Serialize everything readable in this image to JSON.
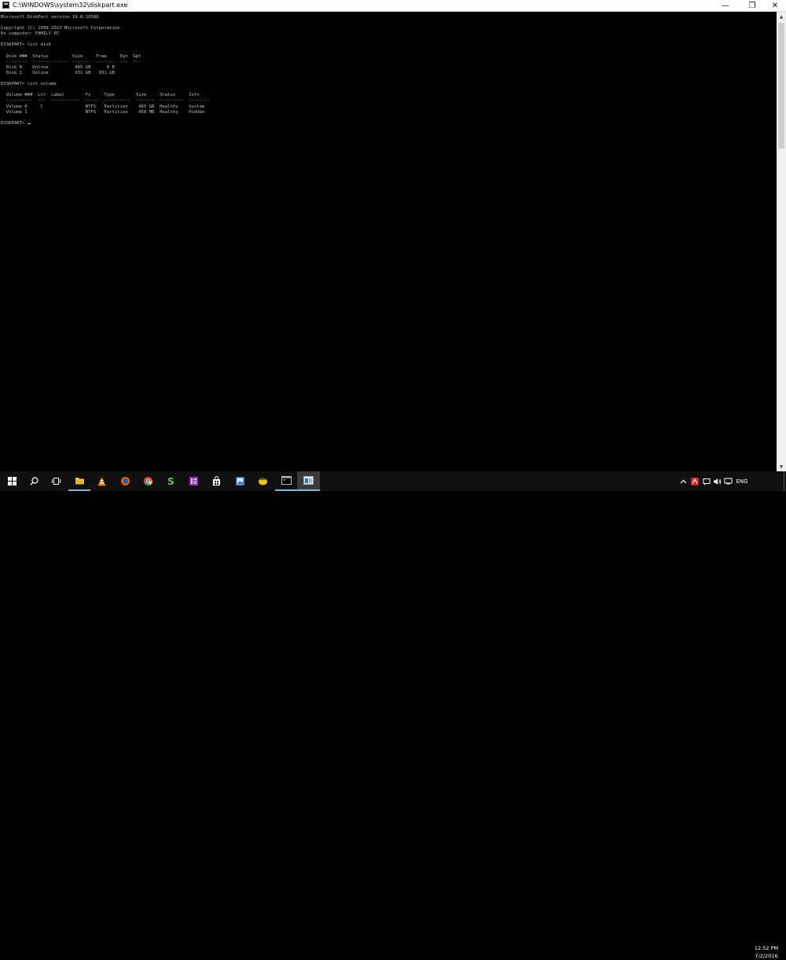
{
  "window": {
    "title": "C:\\WINDOWS\\system32\\diskpart.exe",
    "minimize_glyph": "—",
    "maximize_glyph": "❐",
    "close_glyph": "✕"
  },
  "console": {
    "lines": [
      "Microsoft DiskPart version 10.0.10586",
      "",
      "Copyright (C) 1999-2013 Microsoft Corporation.",
      "On computer: FAMILY-PC",
      "",
      "DISKPART> list disk",
      "",
      "  Disk ###  Status         Size     Free     Dyn  Gpt",
      "  --------  -------------  -------  -------  ---  ---",
      "  Disk 0    Online          465 GB      0 B",
      "  Disk 1    Online          931 GB   931 GB",
      "",
      "DISKPART> list volume",
      "",
      "  Volume ###  Ltr  Label        Fs     Type        Size     Status     Info",
      "  ----------  ---  -----------  -----  ----------  -------  ---------  --------",
      "  Volume 0     C                NTFS   Partition    465 GB  Healthy    System",
      "  Volume 1                      NTFS   Partition    450 MB  Healthy    Hidden",
      ""
    ],
    "prompt": "DISKPART> "
  },
  "scrollbar": {
    "up_glyph": "▲",
    "down_glyph": "▼"
  },
  "taskbar": {
    "apps": [
      {
        "name": "start-button",
        "icon": "windows-logo-icon"
      },
      {
        "name": "search-button",
        "icon": "search-icon"
      },
      {
        "name": "task-view-button",
        "icon": "task-view-icon"
      },
      {
        "name": "taskbar-file-explorer",
        "icon": "folder-icon"
      },
      {
        "name": "taskbar-vlc",
        "icon": "vlc-cone-icon"
      },
      {
        "name": "taskbar-firefox",
        "icon": "firefox-icon"
      },
      {
        "name": "taskbar-chrome",
        "icon": "chrome-icon"
      },
      {
        "name": "taskbar-s-app",
        "icon": "s-app-icon"
      },
      {
        "name": "taskbar-purple-app",
        "icon": "purple-app-icon"
      },
      {
        "name": "taskbar-store",
        "icon": "store-icon"
      },
      {
        "name": "taskbar-photo-app",
        "icon": "photo-app-icon"
      },
      {
        "name": "taskbar-yellow-app",
        "icon": "yellow-app-icon"
      },
      {
        "name": "taskbar-cmd",
        "icon": "cmd-icon"
      },
      {
        "name": "taskbar-diskpart",
        "icon": "diskpart-icon"
      }
    ],
    "tray": {
      "language": "ENG",
      "time": "12:52 PM",
      "date": "7/2/2016"
    }
  },
  "colors": {
    "console_bg": "#000000",
    "console_text": "#c0c0c0",
    "taskbar_bg": "#101010",
    "accent": "#8ab4d8"
  }
}
